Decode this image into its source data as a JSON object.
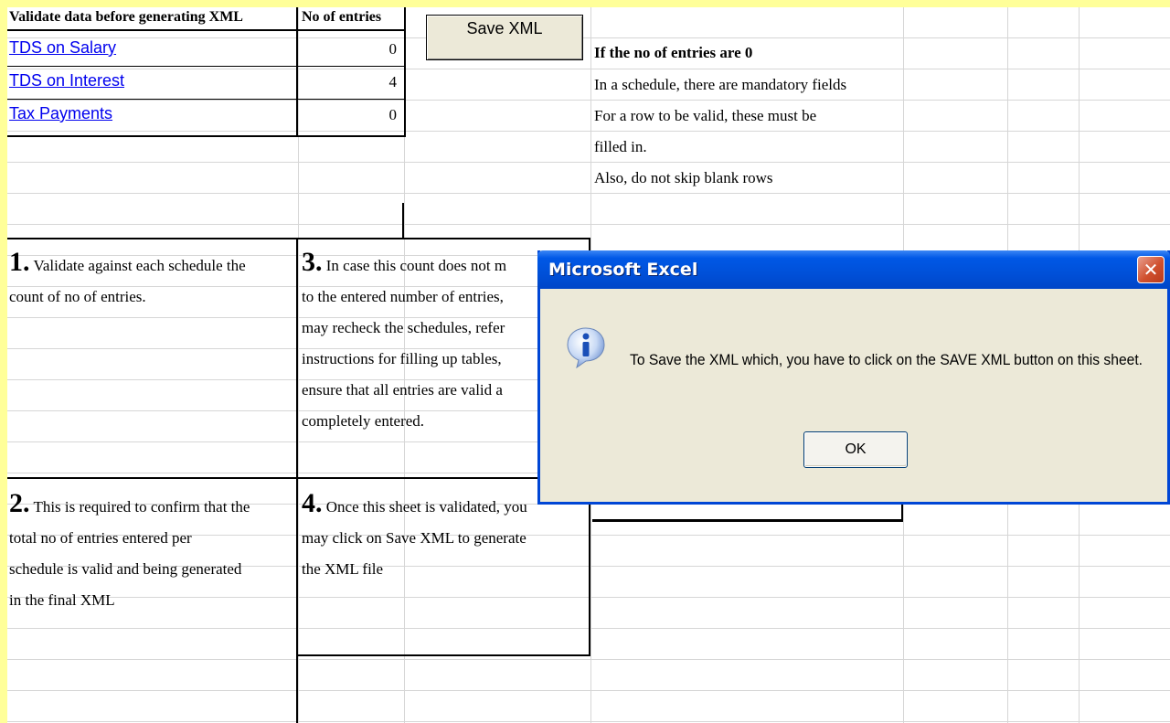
{
  "header": {
    "validate_label": "Validate data before generating XML",
    "entries_label": "No of entries"
  },
  "rows": [
    {
      "label": "TDS on Salary",
      "count": "0"
    },
    {
      "label": "TDS on Interest",
      "count": "4"
    },
    {
      "label": "Tax Payments",
      "count": "0"
    }
  ],
  "toolbar": {
    "save_xml_label": "Save XML"
  },
  "notes": {
    "title": "If the no of entries are 0",
    "lines": [
      "In a schedule, there are mandatory fields",
      "For a row to be valid, these must be",
      "filled in.",
      "Also, do not skip blank rows"
    ]
  },
  "steps": {
    "s1": {
      "num": "1.",
      "lines": [
        "Validate against each schedule the",
        "count of no of entries."
      ]
    },
    "s2": {
      "num": "2.",
      "lines": [
        "This is required to confirm that the",
        "total no of entries entered per",
        "schedule is valid and being generated",
        "in the final XML"
      ]
    },
    "s3": {
      "num": "3.",
      "lines": [
        "In case this count does not m",
        "to the entered number of entries,",
        "may recheck the schedules, refer",
        "instructions for filling up tables,",
        "ensure that all entries are valid a",
        "completely entered."
      ]
    },
    "s4": {
      "num": "4.",
      "lines": [
        "Once this sheet is validated, you",
        "may click on Save XML to generate",
        "the XML file"
      ]
    }
  },
  "dialog": {
    "title": "Microsoft Excel",
    "message": "To Save the XML which, you have to click on the SAVE XML button on this sheet.",
    "ok_label": "OK",
    "icon": "info-icon",
    "close_icon": "close-icon"
  },
  "colors": {
    "slide_background": "#ffff99",
    "dialog_titlebar": "#0058e6",
    "link": "#0000ee"
  }
}
